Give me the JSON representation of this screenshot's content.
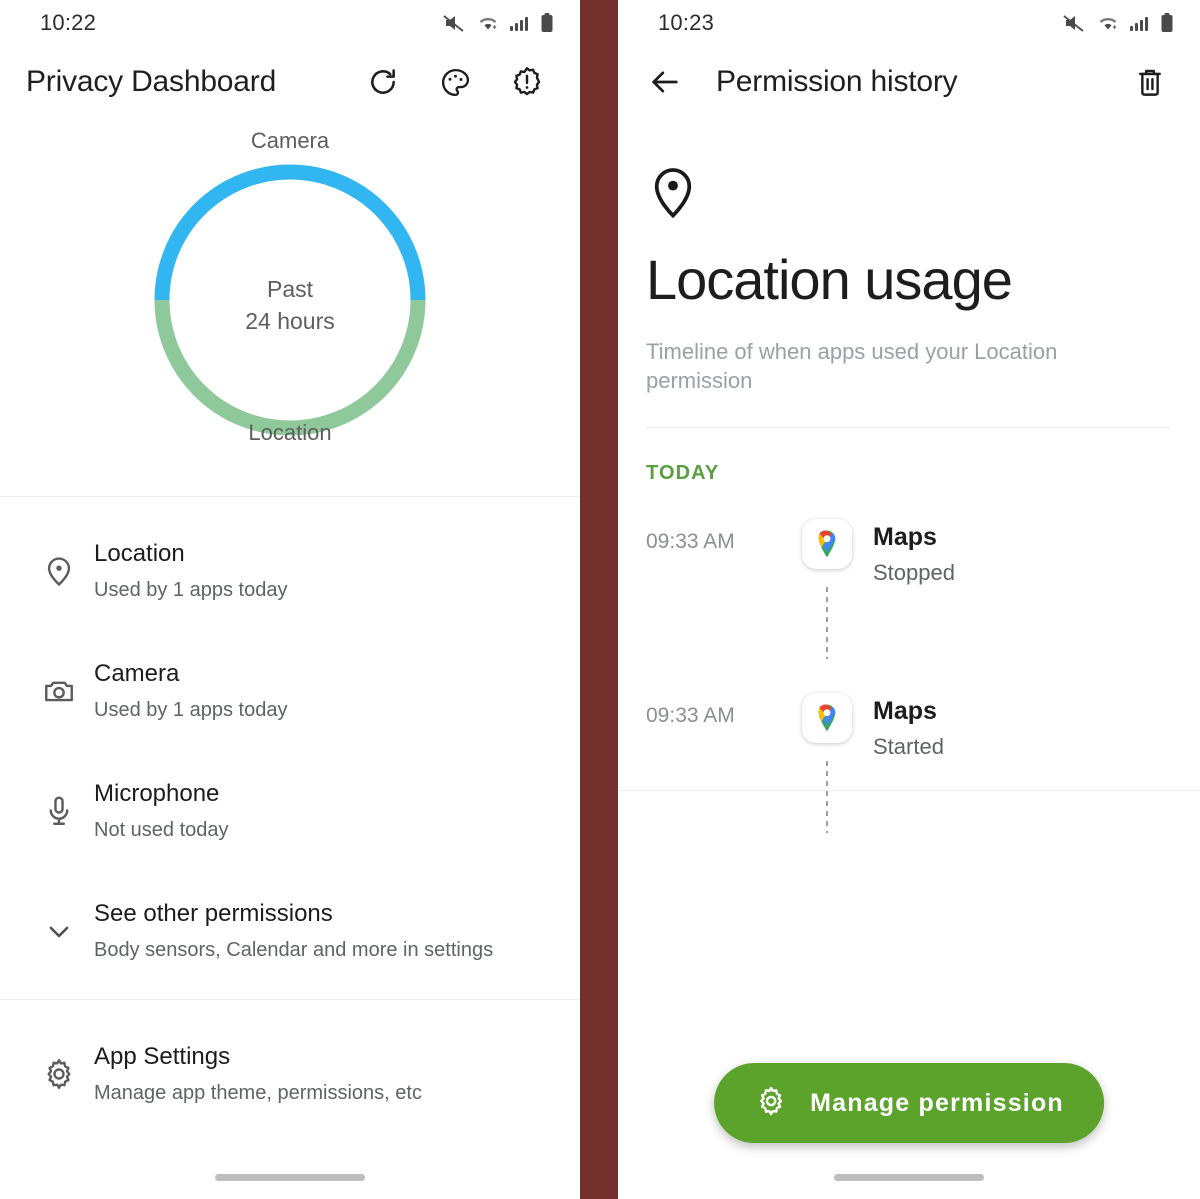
{
  "left": {
    "status_bar": {
      "time": "10:22",
      "icons": [
        "mute-icon",
        "wifi-icon",
        "signal-icon",
        "battery-icon"
      ]
    },
    "toolbar": {
      "title": "Privacy Dashboard",
      "actions": [
        {
          "name": "refresh-icon",
          "label": "Refresh"
        },
        {
          "name": "palette-icon",
          "label": "Theme"
        },
        {
          "name": "info-badge-icon",
          "label": "About"
        }
      ]
    },
    "chart_data": {
      "type": "pie",
      "title": "Past 24 hours",
      "center_line1": "Past",
      "center_line2": "24 hours",
      "categories": [
        "Camera",
        "Location"
      ],
      "values": [
        50,
        50
      ],
      "colors": [
        "#31b6f1",
        "#8fc89b"
      ],
      "labels": {
        "top": "Camera",
        "bottom": "Location"
      },
      "legend": "inline-labels",
      "unit": "percent"
    },
    "permissions": [
      {
        "icon": "location-pin-icon",
        "title": "Location",
        "subtitle": "Used by 1 apps today"
      },
      {
        "icon": "camera-icon",
        "title": "Camera",
        "subtitle": "Used by 1 apps today"
      },
      {
        "icon": "microphone-icon",
        "title": "Microphone",
        "subtitle": "Not used today"
      },
      {
        "icon": "chevron-down-icon",
        "title": "See other permissions",
        "subtitle": "Body sensors, Calendar and more in settings"
      }
    ],
    "app_settings": {
      "icon": "gear-icon",
      "title": "App Settings",
      "subtitle": "Manage app theme, permissions, etc"
    }
  },
  "right": {
    "status_bar": {
      "time": "10:23",
      "icons": [
        "mute-icon",
        "wifi-icon",
        "signal-icon",
        "battery-icon"
      ]
    },
    "toolbar": {
      "back_icon": "arrow-left-icon",
      "title": "Permission history",
      "delete_icon": "trash-icon"
    },
    "hero": {
      "icon": "location-pin-icon",
      "title": "Location usage",
      "subtitle": "Timeline of when apps used your Location permission"
    },
    "timeline": {
      "section_label": "TODAY",
      "entries": [
        {
          "time": "09:33 AM",
          "app": "Maps",
          "app_icon": "google-maps-icon",
          "state": "Stopped"
        },
        {
          "time": "09:33 AM",
          "app": "Maps",
          "app_icon": "google-maps-icon",
          "state": "Started"
        }
      ]
    },
    "fab": {
      "icon": "gear-icon",
      "label": "Manage permission",
      "color": "#5ba32b"
    }
  },
  "theme": {
    "divider_band": "#73302d",
    "accent_green": "#5a9e3f",
    "camera_blue": "#31b6f1",
    "location_green": "#8fc89b"
  }
}
